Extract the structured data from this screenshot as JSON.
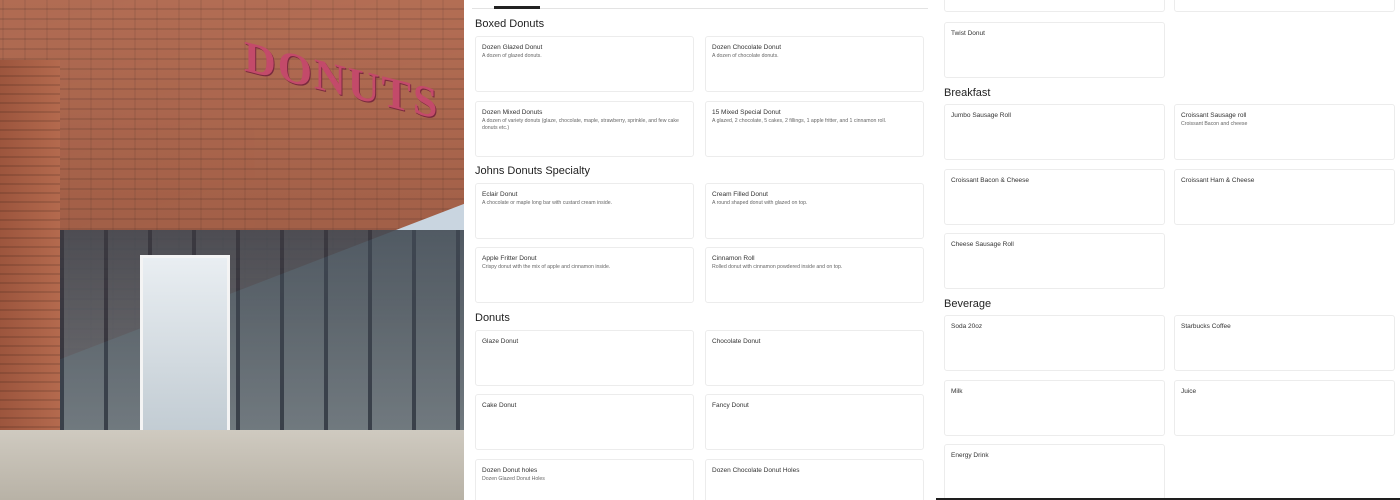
{
  "sections": {
    "boxed": {
      "title": "Boxed Donuts",
      "items": [
        {
          "name": "Dozen Glazed Donut",
          "desc": "A dozen of glazed donuts."
        },
        {
          "name": "Dozen Chocolate Donut",
          "desc": "A dozen of chocolate donuts."
        },
        {
          "name": "Dozen Mixed Donuts",
          "desc": "A dozen of variety donuts (glaze, chocolate, maple, strawberry, sprinkle, and few cake donuts etc.)"
        },
        {
          "name": "15 Mixed Special Donut",
          "desc": "A glazed, 2 chocolate, 5 cakes, 2 fillings, 1 apple fritter, and 1 cinnamon roll."
        }
      ]
    },
    "specialty": {
      "title": "Johns Donuts Specialty",
      "items": [
        {
          "name": "Eclair Donut",
          "desc": "A chocolate or maple long bar with custard cream inside."
        },
        {
          "name": "Cream Filled Donut",
          "desc": "A round shaped donut with glazed on top."
        },
        {
          "name": "Apple Fritter Donut",
          "desc": "Crispy donut with the mix of apple and cinnamon inside."
        },
        {
          "name": "Cinnamon Roll",
          "desc": "Rolled donut with cinnamon powdered inside and on top."
        }
      ]
    },
    "donuts": {
      "title": "Donuts",
      "items": [
        {
          "name": "Glaze Donut",
          "desc": ""
        },
        {
          "name": "Chocolate Donut",
          "desc": ""
        },
        {
          "name": "Cake  Donut",
          "desc": ""
        },
        {
          "name": "Fancy Donut",
          "desc": ""
        },
        {
          "name": "Dozen Donut holes",
          "desc": "Dozen Glazed Donut Holes"
        },
        {
          "name": "Dozen Chocolate Donut Holes",
          "desc": ""
        }
      ]
    },
    "misc": {
      "items": [
        {
          "name": "Twist Donut",
          "desc": ""
        }
      ]
    },
    "breakfast": {
      "title": "Breakfast",
      "items": [
        {
          "name": "Jumbo Sausage Roll",
          "desc": ""
        },
        {
          "name": "Croissant Sausage roll",
          "desc": "Croissant Bacon and cheese"
        },
        {
          "name": "Croissant Bacon & Cheese",
          "desc": ""
        },
        {
          "name": "Croissant Ham & Cheese",
          "desc": ""
        },
        {
          "name": "Cheese Sausage Roll",
          "desc": ""
        }
      ]
    },
    "beverage": {
      "title": "Beverage",
      "items": [
        {
          "name": "Soda 20oz",
          "desc": ""
        },
        {
          "name": "Starbucks Coffee",
          "desc": ""
        },
        {
          "name": "Milk",
          "desc": ""
        },
        {
          "name": "Juice",
          "desc": ""
        },
        {
          "name": "Energy Drink",
          "desc": ""
        }
      ]
    }
  },
  "hero": {
    "sign_text": "DONUTS"
  }
}
